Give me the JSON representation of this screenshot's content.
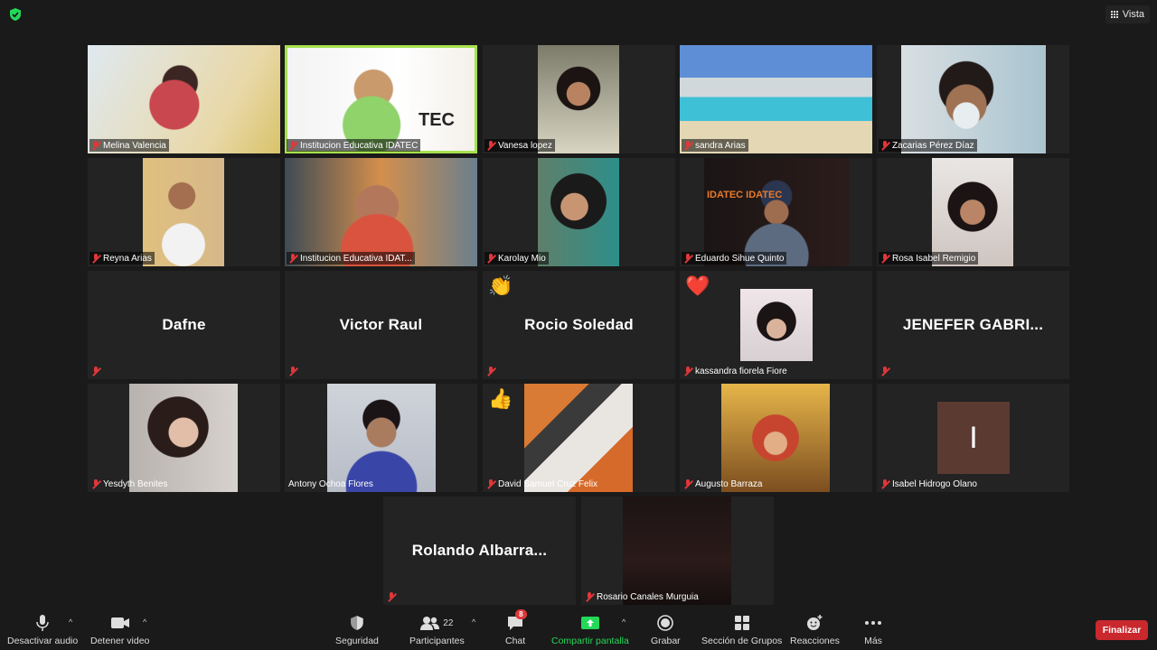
{
  "top": {
    "view_label": "Vista"
  },
  "participants": [
    {
      "name": "Melina Valencia",
      "video": true
    },
    {
      "name": "Institucion Educativa IDATEC",
      "video": true,
      "active": true
    },
    {
      "name": "Vanesa lopez",
      "video": true
    },
    {
      "name": "sandra Arias",
      "video": true
    },
    {
      "name": "Zacarias Pérez Díaz",
      "video": true
    },
    {
      "name": "Reyna Arias",
      "video": true
    },
    {
      "name": "Institucion Educativa IDAT...",
      "video": true
    },
    {
      "name": "Karolay Mio",
      "video": true
    },
    {
      "name": "Eduardo Sihue Quinto",
      "video": true
    },
    {
      "name": "Rosa Isabel Remigio",
      "video": true
    },
    {
      "name": "Dafne",
      "video": false,
      "display": "Dafne"
    },
    {
      "name": "Victor Raul",
      "video": false,
      "display": "Victor Raul"
    },
    {
      "name": "Rocio Soledad",
      "video": false,
      "display": "Rocio Soledad",
      "reaction": "👏"
    },
    {
      "name": "kassandra fiorela Fiore",
      "video": true,
      "reaction": "❤️"
    },
    {
      "name": "JENEFER GABRI...",
      "video": false,
      "display": "JENEFER  GABRI..."
    },
    {
      "name": "Yesdyth Benites",
      "video": true
    },
    {
      "name": "Antony Ochoa Flores",
      "video": true
    },
    {
      "name": "David Samuel Cruz Felix",
      "video": true,
      "reaction": "👍"
    },
    {
      "name": "Augusto Barraza",
      "video": true
    },
    {
      "name": "Isabel Hidrogo Olano",
      "video": false,
      "initial": "I"
    },
    {
      "name": "Rolando Albarra...",
      "video": false,
      "display": "Rolando  Albarra..."
    },
    {
      "name": "Rosario Canales Murguia",
      "video": true
    }
  ],
  "toolbar": {
    "mute_label": "Desactivar audio",
    "video_label": "Detener video",
    "security_label": "Seguridad",
    "participants_label": "Participantes",
    "participants_count": "22",
    "chat_label": "Chat",
    "chat_badge": "8",
    "share_label": "Compartir pantalla",
    "record_label": "Grabar",
    "breakout_label": "Sección de Grupos",
    "reactions_label": "Reacciones",
    "more_label": "Más",
    "end_label": "Finalizar"
  },
  "colors": {
    "share_green": "#23d959",
    "end_red": "#c9282d",
    "active_border": "#a6e14e",
    "muted_red": "#e0373a"
  }
}
